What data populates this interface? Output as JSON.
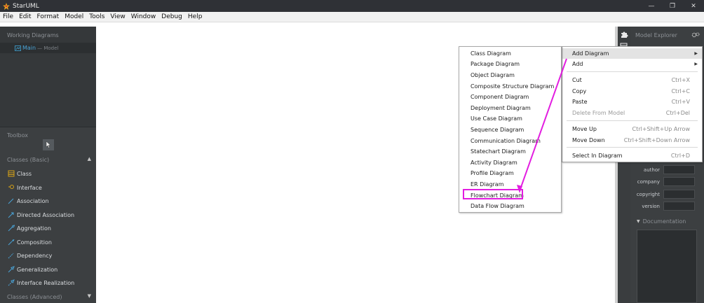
{
  "window": {
    "title": "StarUML",
    "controls": [
      "—",
      "❐",
      "✕"
    ]
  },
  "menubar": {
    "items": [
      "File",
      "Edit",
      "Format",
      "Model",
      "Tools",
      "View",
      "Window",
      "Debug",
      "Help"
    ]
  },
  "working_diagrams": {
    "title": "Working Diagrams",
    "items": [
      {
        "name": "Main",
        "owner": "— Model"
      }
    ]
  },
  "toolbox": {
    "title": "Toolbox",
    "group_basic": "Classes (Basic)",
    "group_advanced": "Classes (Advanced)",
    "items": [
      "Class",
      "Interface",
      "Association",
      "Directed Association",
      "Aggregation",
      "Composition",
      "Dependency",
      "Generalization",
      "Interface Realization"
    ]
  },
  "model_explorer": {
    "title": "Model Explorer"
  },
  "properties": [
    {
      "label": "author"
    },
    {
      "label": "company"
    },
    {
      "label": "copyright"
    },
    {
      "label": "version"
    }
  ],
  "documentation": {
    "title": "Documentation"
  },
  "context_menu": {
    "items": [
      {
        "label": "Add Diagram",
        "submenu": "▶"
      },
      {
        "label": "Add",
        "submenu": "▶"
      },
      {
        "label": "Cut",
        "shortcut": "Ctrl+X"
      },
      {
        "label": "Copy",
        "shortcut": "Ctrl+C"
      },
      {
        "label": "Paste",
        "shortcut": "Ctrl+V"
      },
      {
        "label": "Delete From Model",
        "shortcut": "Ctrl+Del"
      },
      {
        "label": "Move Up",
        "shortcut": "Ctrl+Shift+Up Arrow"
      },
      {
        "label": "Move Down",
        "shortcut": "Ctrl+Shift+Down Arrow"
      },
      {
        "label": "Select In Diagram",
        "shortcut": "Ctrl+D"
      }
    ]
  },
  "add_diagram_submenu": {
    "items": [
      "Class Diagram",
      "Package Diagram",
      "Object Diagram",
      "Composite Structure Diagram",
      "Component Diagram",
      "Deployment Diagram",
      "Use Case Diagram",
      "Sequence Diagram",
      "Communication Diagram",
      "Statechart Diagram",
      "Activity Diagram",
      "Profile Diagram",
      "ER Diagram",
      "Flowchart Diagram",
      "Data Flow Diagram"
    ],
    "highlighted": "Flowchart Diagram"
  },
  "colors": {
    "annotation": "#e21de0",
    "sidebar_bg": "#3c3f41",
    "titlebar_bg": "#2f3136",
    "accent_blue": "#4aa3d6"
  }
}
